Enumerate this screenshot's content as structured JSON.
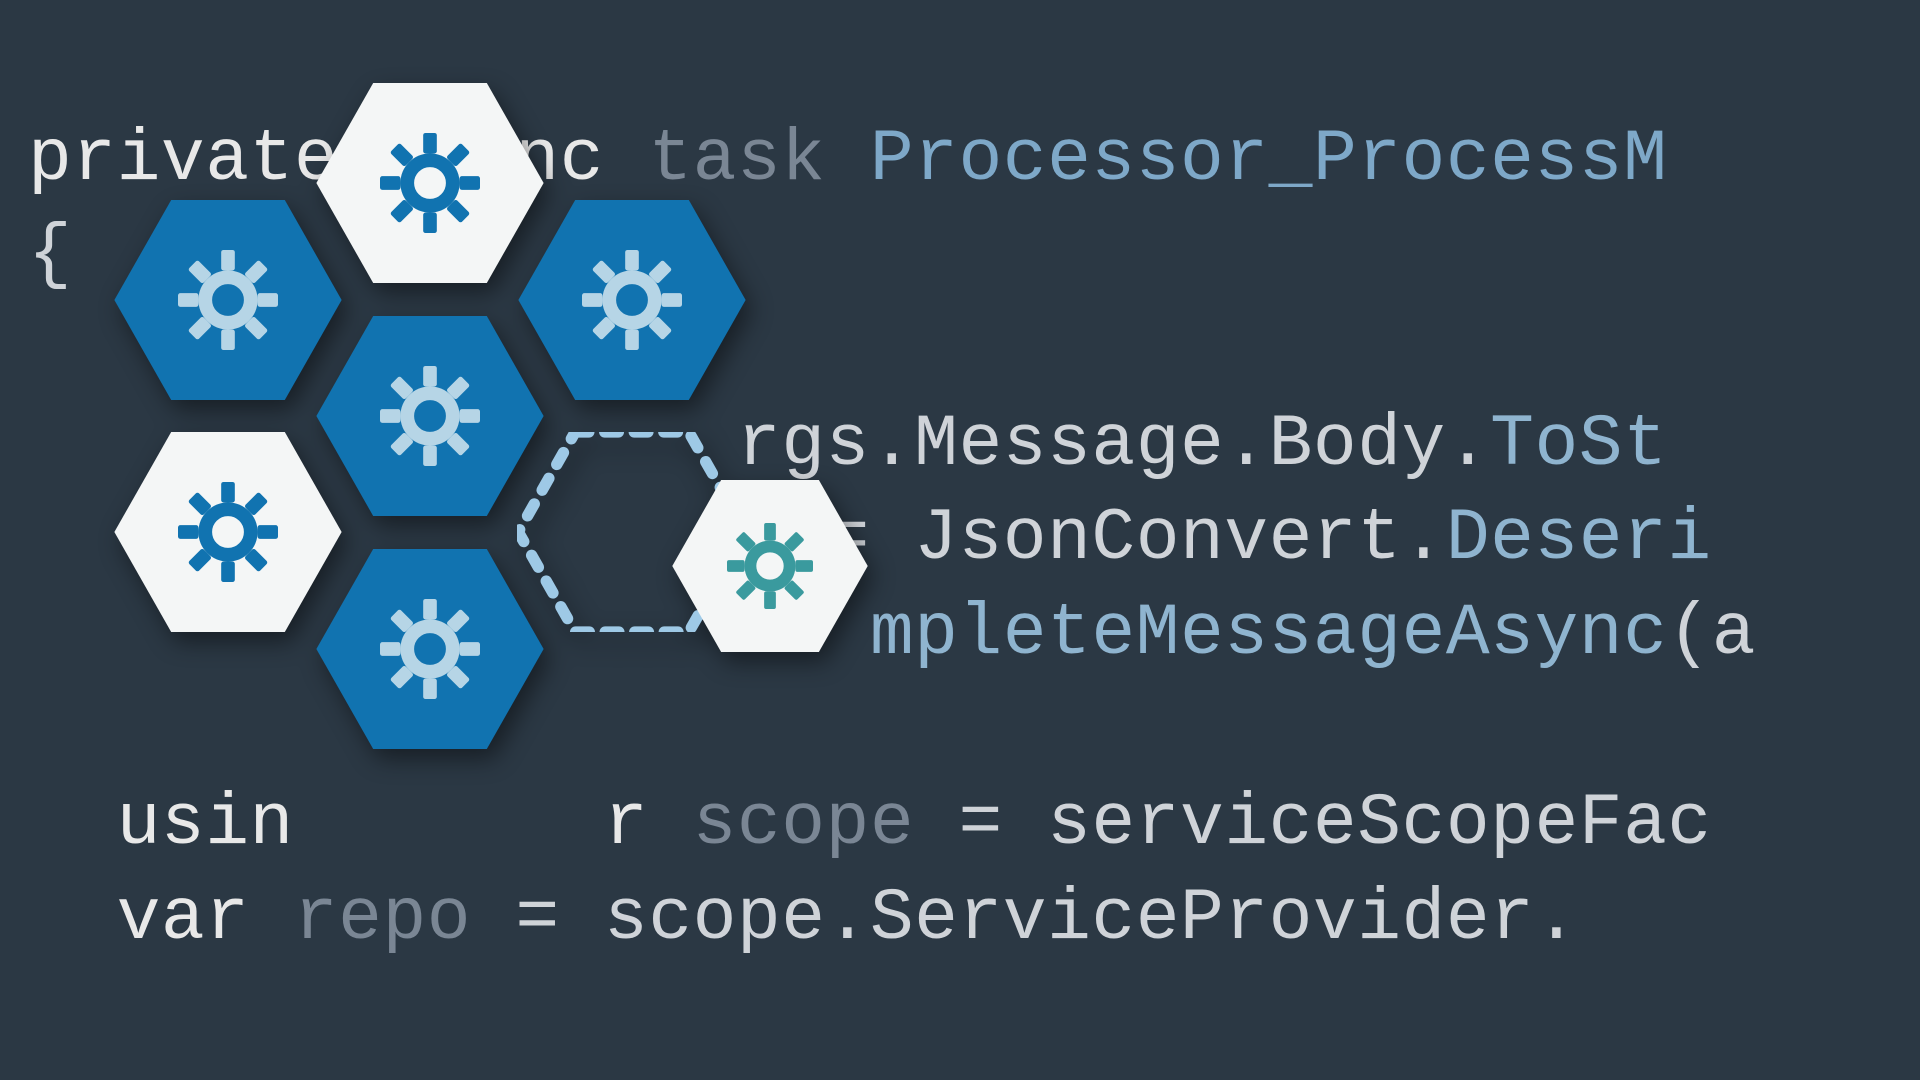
{
  "code": {
    "line1": {
      "tok1": "private",
      "tok2": "async",
      "tok3": "task",
      "tok4": "Processor_ProcessM"
    },
    "line2": "{",
    "line3": {
      "pre": "                rgs",
      "dot1": ".",
      "m1": "Message",
      "dot2": ".",
      "m2": "Body",
      "dot3": ".",
      "call": "ToSt"
    },
    "line4": {
      "pre": "                  = ",
      "cls": "JsonConvert",
      "dot": ".",
      "call": "Deseri"
    },
    "line5": {
      "pre": "                   ",
      "m1": "mpleteMessageAsync",
      "open": "(",
      "arg": "a"
    },
    "line6": "",
    "line7": {
      "kw1": "usin       r ",
      "id": "scope",
      "eq": " = ",
      "rhs": "serviceScopeFac"
    },
    "line8": {
      "kw1": "var ",
      "id": "repo",
      "eq": " = ",
      "rhs": "scope.ServiceProvider",
      "dot": "."
    }
  },
  "cluster": {
    "description": "microservices hexagon cluster"
  }
}
